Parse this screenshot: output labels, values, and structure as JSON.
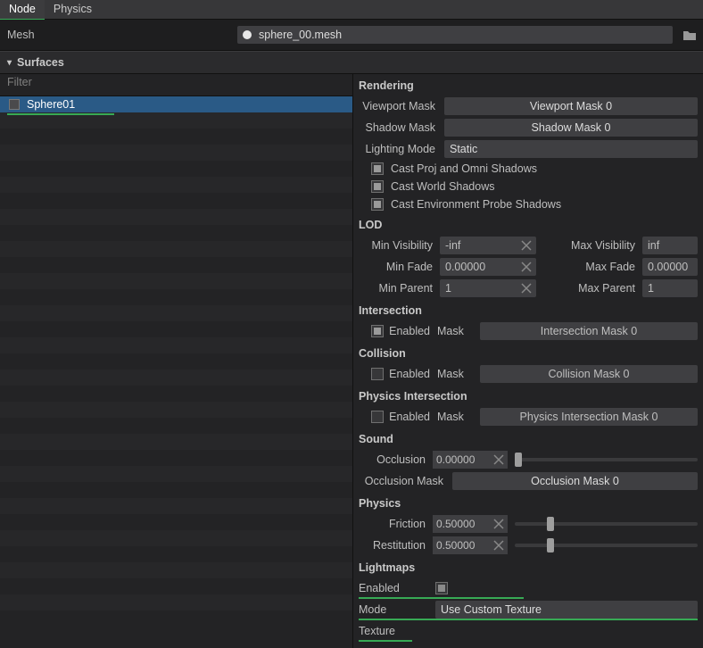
{
  "tabs": {
    "node": "Node",
    "physics": "Physics"
  },
  "mesh": {
    "label": "Mesh",
    "value": "sphere_00.mesh"
  },
  "surfaces": {
    "header": "Surfaces",
    "filter_placeholder": "Filter",
    "items": [
      "Sphere01"
    ]
  },
  "rendering": {
    "title": "Rendering",
    "viewport_mask_label": "Viewport Mask",
    "viewport_mask_value": "Viewport Mask 0",
    "shadow_mask_label": "Shadow Mask",
    "shadow_mask_value": "Shadow Mask 0",
    "lighting_mode_label": "Lighting Mode",
    "lighting_mode_value": "Static",
    "cast_proj_omni": "Cast Proj and Omni Shadows",
    "cast_world": "Cast World Shadows",
    "cast_env": "Cast Environment Probe Shadows"
  },
  "lod": {
    "title": "LOD",
    "min_visibility_label": "Min Visibility",
    "min_visibility_value": "-inf",
    "max_visibility_label": "Max Visibility",
    "max_visibility_value": "inf",
    "min_fade_label": "Min Fade",
    "min_fade_value": "0.00000",
    "max_fade_label": "Max Fade",
    "max_fade_value": "0.00000",
    "min_parent_label": "Min Parent",
    "min_parent_value": "1",
    "max_parent_label": "Max Parent",
    "max_parent_value": "1"
  },
  "intersection": {
    "title": "Intersection",
    "enabled_label": "Enabled",
    "mask_label": "Mask",
    "mask_value": "Intersection Mask 0",
    "enabled": true
  },
  "collision": {
    "title": "Collision",
    "enabled_label": "Enabled",
    "mask_label": "Mask",
    "mask_value": "Collision Mask 0",
    "enabled": false
  },
  "physics_intersection": {
    "title": "Physics Intersection",
    "enabled_label": "Enabled",
    "mask_label": "Mask",
    "mask_value": "Physics Intersection Mask 0",
    "enabled": false
  },
  "sound": {
    "title": "Sound",
    "occlusion_label": "Occlusion",
    "occlusion_value": "0.00000",
    "occlusion_mask_label": "Occlusion Mask",
    "occlusion_mask_value": "Occlusion Mask 0"
  },
  "physics": {
    "title": "Physics",
    "friction_label": "Friction",
    "friction_value": "0.50000",
    "restitution_label": "Restitution",
    "restitution_value": "0.50000"
  },
  "lightmaps": {
    "title": "Lightmaps",
    "enabled_label": "Enabled",
    "mode_label": "Mode",
    "mode_value": "Use Custom Texture",
    "texture_label": "Texture"
  }
}
